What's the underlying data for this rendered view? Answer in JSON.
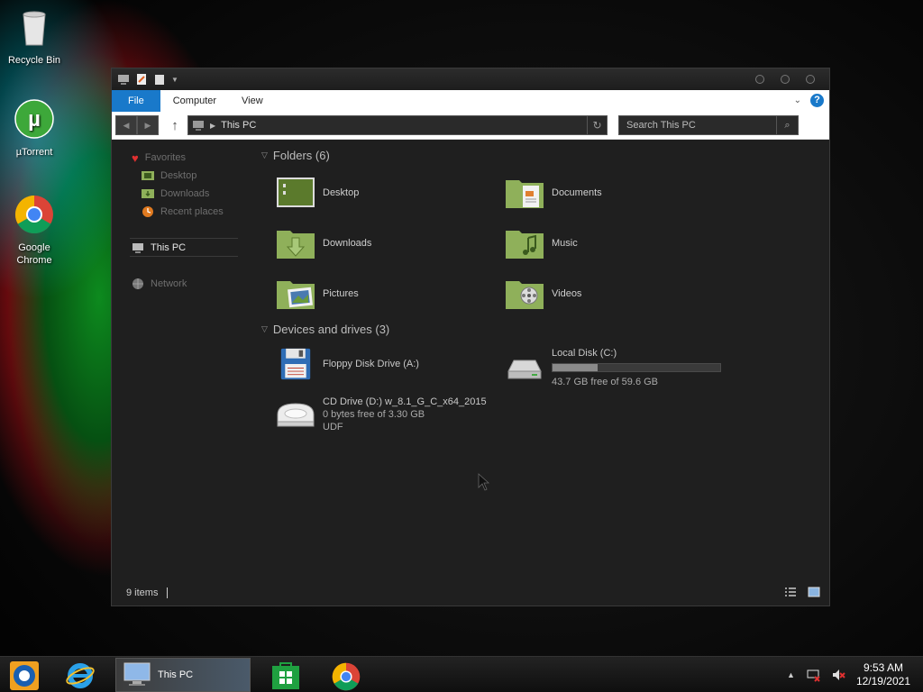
{
  "desktop": {
    "icons": [
      {
        "label": "Recycle Bin"
      },
      {
        "label": "µTorrent"
      },
      {
        "label": "Google Chrome"
      }
    ]
  },
  "window": {
    "ribbon_tabs": [
      "File",
      "Computer",
      "View"
    ],
    "address": {
      "path": "This PC"
    },
    "search": {
      "placeholder": "Search This PC"
    },
    "nav": {
      "favorites": "Favorites",
      "desktop": "Desktop",
      "downloads": "Downloads",
      "recent": "Recent places",
      "this_pc": "This PC",
      "network": "Network"
    },
    "folders_header": "Folders (6)",
    "folders": [
      "Desktop",
      "Documents",
      "Downloads",
      "Music",
      "Pictures",
      "Videos"
    ],
    "devices_header": "Devices and drives (3)",
    "drives": {
      "floppy": {
        "name": "Floppy Disk Drive (A:)"
      },
      "local": {
        "name": "Local Disk (C:)",
        "free": "43.7 GB free of 59.6 GB",
        "used_fraction": 0.267
      },
      "cd": {
        "name": "CD Drive (D:) w_8.1_G_C_x64_2015",
        "free": "0 bytes free of 3.30 GB",
        "fs": "UDF"
      }
    },
    "status": {
      "items": "9 items"
    }
  },
  "taskbar": {
    "active_label": "This PC",
    "clock": {
      "time": "9:53 AM",
      "date": "12/19/2021"
    }
  },
  "colors": {
    "accent": "#1979ca",
    "folder_green": "#8fb05a",
    "window_bg": "#1f1f1f"
  }
}
